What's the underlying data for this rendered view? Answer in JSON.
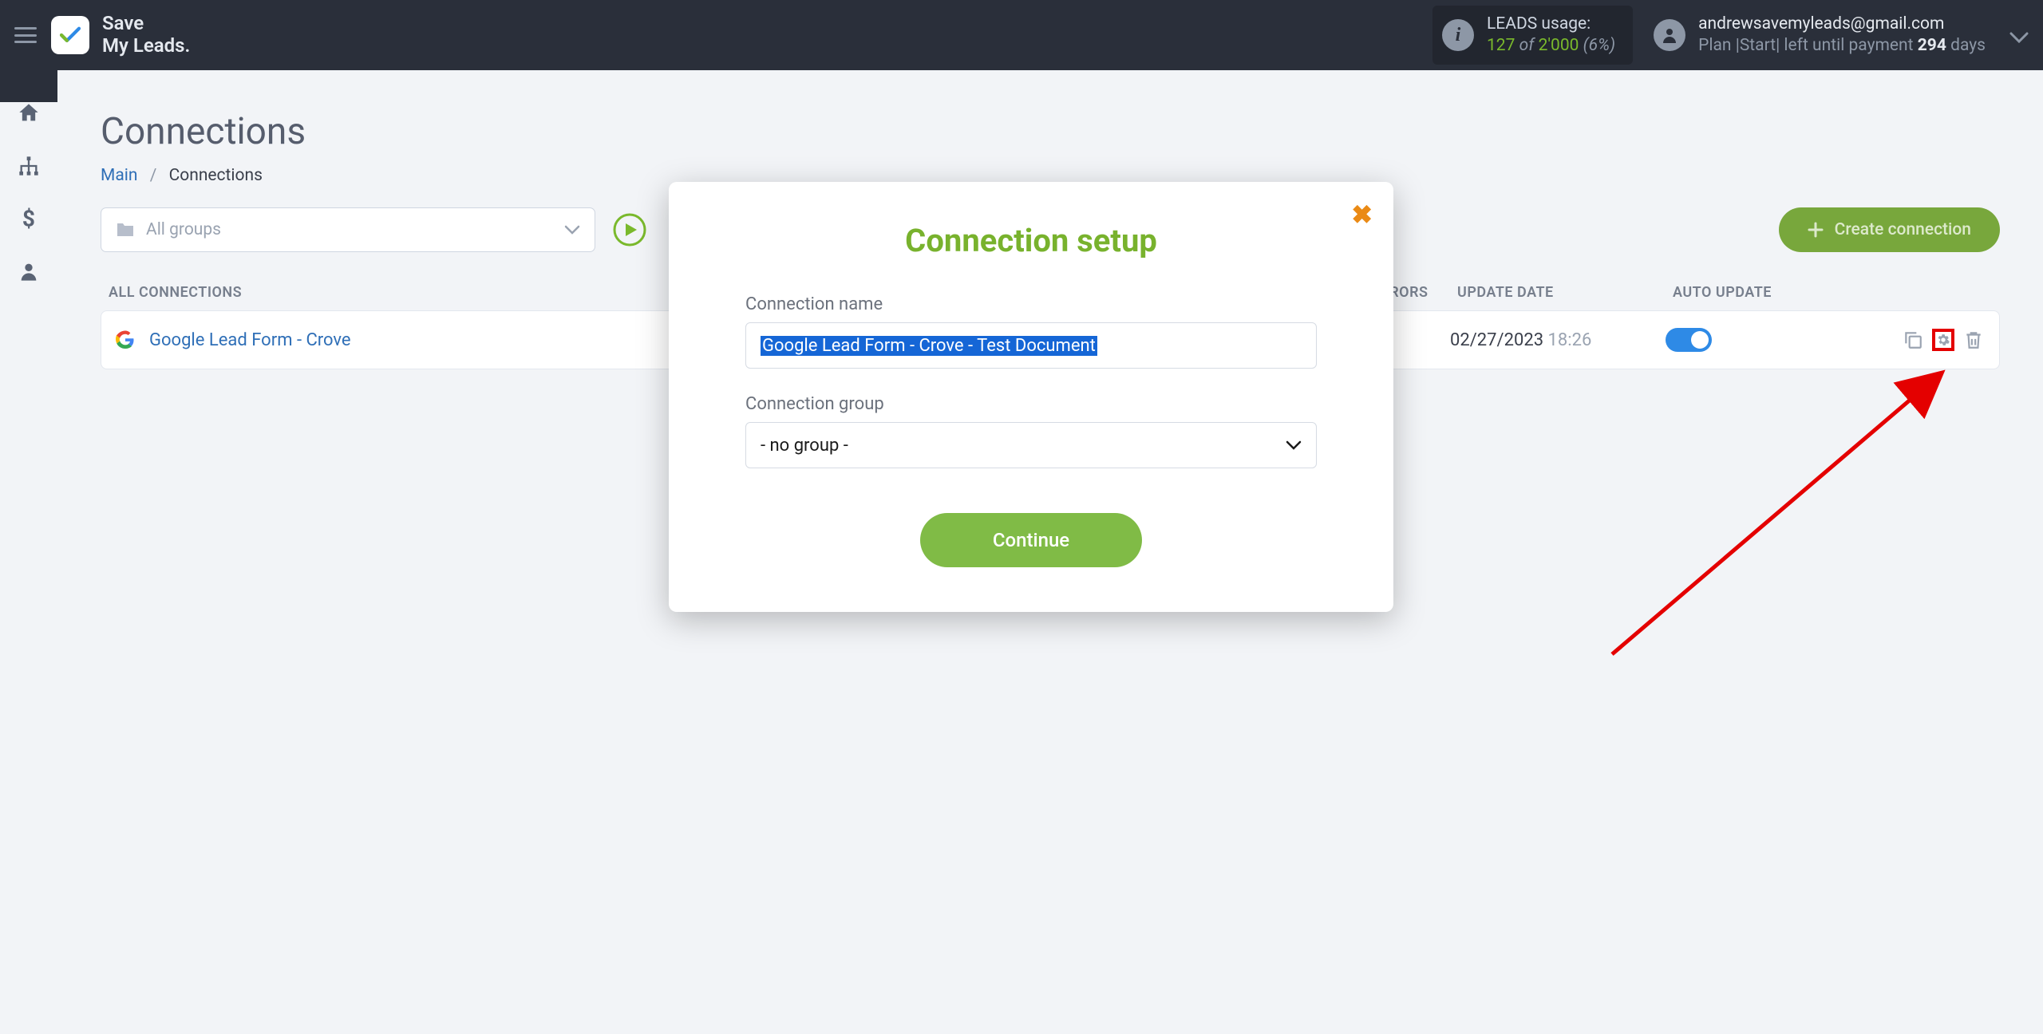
{
  "brand": {
    "line1": "Save",
    "line2": "My Leads."
  },
  "header": {
    "usage_label": "LEADS usage:",
    "usage_used": "127",
    "usage_of": "of",
    "usage_total": "2'000",
    "usage_pct": "(6%)",
    "email": "andrewsavemyleads@gmail.com",
    "plan_prefix": "Plan |Start| left until payment ",
    "plan_days": "294",
    "plan_suffix": " days"
  },
  "page": {
    "title": "Connections",
    "breadcrumb_main": "Main",
    "breadcrumb_current": "Connections",
    "groups_select": "All groups",
    "create_btn": "Create connection"
  },
  "columns": {
    "all": "ALL CONNECTIONS",
    "log": "LOG / ERRORS",
    "date": "UPDATE DATE",
    "auto": "AUTO UPDATE"
  },
  "rows": [
    {
      "name": "Google Lead Form - Crove",
      "date": "02/27/2023",
      "time": "18:26"
    }
  ],
  "modal": {
    "title": "Connection setup",
    "name_label": "Connection name",
    "name_value": "Google Lead Form - Crove - Test Document",
    "group_label": "Connection group",
    "group_value": "- no group -",
    "continue": "Continue"
  }
}
